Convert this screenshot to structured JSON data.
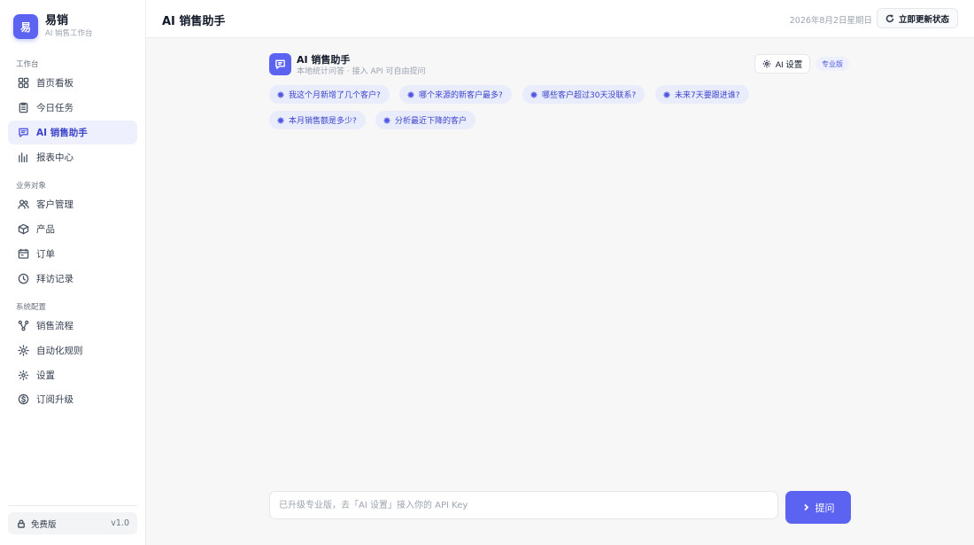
{
  "brand": {
    "logo_char": "易",
    "name": "易销",
    "subtitle": "AI 销售工作台"
  },
  "sidebar": {
    "groups": [
      {
        "label": "工作台",
        "items": [
          {
            "label": "首页看板",
            "icon": "dashboard-icon"
          },
          {
            "label": "今日任务",
            "icon": "clipboard-icon"
          },
          {
            "label": "AI 销售助手",
            "icon": "chat-icon",
            "active": true
          },
          {
            "label": "报表中心",
            "icon": "bar-chart-icon"
          }
        ]
      },
      {
        "label": "业务对象",
        "items": [
          {
            "label": "客户管理",
            "icon": "users-icon"
          },
          {
            "label": "产品",
            "icon": "box-icon"
          },
          {
            "label": "订单",
            "icon": "order-icon"
          },
          {
            "label": "拜访记录",
            "icon": "clock-icon"
          }
        ]
      },
      {
        "label": "系统配置",
        "items": [
          {
            "label": "销售流程",
            "icon": "flow-icon"
          },
          {
            "label": "自动化规则",
            "icon": "sparkle-icon"
          },
          {
            "label": "设置",
            "icon": "gear-icon"
          },
          {
            "label": "订阅升级",
            "icon": "dollar-icon"
          }
        ]
      }
    ],
    "plan": {
      "label": "免费版",
      "version": "v1.0",
      "icon": "lock-icon"
    }
  },
  "header": {
    "title": "AI 销售助手",
    "date": "2026年8月2日星期日",
    "refresh_label": "立即更新状态"
  },
  "assistant": {
    "title": "AI 销售助手",
    "subtitle": "本地统计问答 · 接入 API 可自由提问",
    "settings_label": "AI 设置",
    "badge": "专业版",
    "suggestions": [
      "我这个月新增了几个客户?",
      "哪个来源的新客户最多?",
      "哪些客户超过30天没联系?",
      "未来7天要跟进谁?",
      "本月销售额是多少?",
      "分析最近下降的客户"
    ]
  },
  "composer": {
    "placeholder": "已升级专业版，去「AI 设置」接入你的 API Key",
    "submit_label": "提问"
  },
  "colors": {
    "accent": "#5b63f0",
    "accent_soft": "#eef0fd",
    "chip_bg": "#e9ecfb"
  }
}
